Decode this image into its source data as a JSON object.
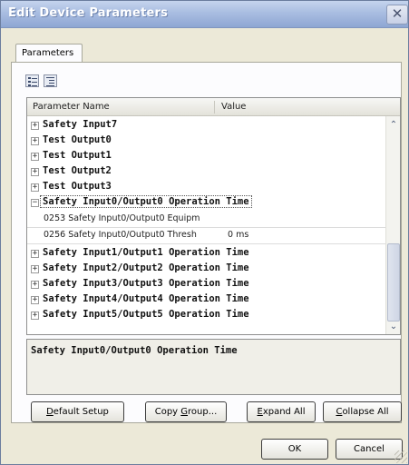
{
  "window": {
    "title": "Edit Device Parameters",
    "close_glyph": "✕"
  },
  "tabs": [
    {
      "label": "Parameters"
    }
  ],
  "grid": {
    "columns": [
      "Parameter Name",
      "Value"
    ],
    "rows": [
      {
        "kind": "group",
        "expander": "+",
        "label": "Safety Input7"
      },
      {
        "kind": "group",
        "expander": "+",
        "label": "Test Output0"
      },
      {
        "kind": "group",
        "expander": "+",
        "label": "Test Output1"
      },
      {
        "kind": "group",
        "expander": "+",
        "label": "Test Output2"
      },
      {
        "kind": "group",
        "expander": "+",
        "label": "Test Output3"
      },
      {
        "kind": "group",
        "expander": "−",
        "label": "Safety Input0/Output0 Operation Time"
      },
      {
        "kind": "param",
        "name": "0253 Safety Input0/Output0 Equipm",
        "value": ""
      },
      {
        "kind": "param",
        "name": "0256 Safety Input0/Output0 Thresh",
        "value": "0 ms"
      },
      {
        "kind": "group",
        "expander": "+",
        "label": "Safety Input1/Output1 Operation Time"
      },
      {
        "kind": "group",
        "expander": "+",
        "label": "Safety Input2/Output2 Operation Time"
      },
      {
        "kind": "group",
        "expander": "+",
        "label": "Safety Input3/Output3 Operation Time"
      },
      {
        "kind": "group",
        "expander": "+",
        "label": "Safety Input4/Output4 Operation Time"
      },
      {
        "kind": "group",
        "expander": "+",
        "label": "Safety Input5/Output5 Operation Time"
      }
    ],
    "scroll_up": "⌃",
    "scroll_down": "⌄"
  },
  "description": {
    "text": "Safety Input0/Output0 Operation Time"
  },
  "buttons": {
    "default_setup": {
      "mnemonic": "D",
      "rest": "efault Setup"
    },
    "copy_group": {
      "pre": "Copy ",
      "mnemonic": "G",
      "rest": "roup..."
    },
    "expand_all": {
      "mnemonic": "E",
      "rest": "xpand All"
    },
    "collapse_all": {
      "mnemonic": "C",
      "rest": "ollapse All"
    },
    "ok": "OK",
    "cancel": "Cancel"
  }
}
